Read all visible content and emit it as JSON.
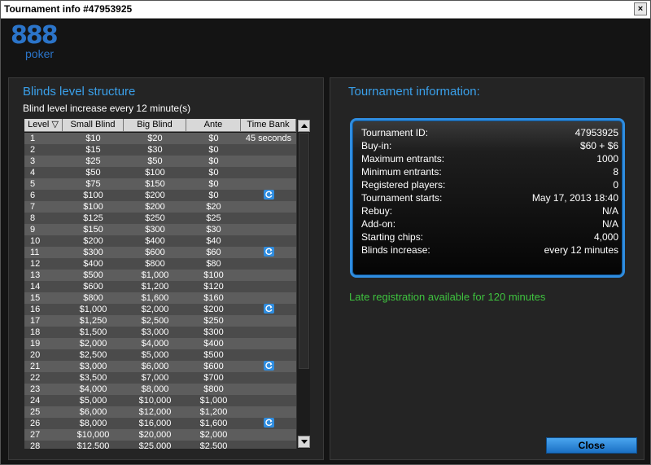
{
  "window": {
    "title": "Tournament info #47953925",
    "close_glyph": "×"
  },
  "logo": {
    "brand": "888",
    "sub": "poker"
  },
  "blinds": {
    "title": "Blinds level structure",
    "subtitle": "Blind level increase every 12 minute(s)",
    "columns": [
      "Level",
      "Small Blind",
      "Big Blind",
      "Ante",
      "Time Bank"
    ],
    "sort_glyph": "▽",
    "rows": [
      {
        "level": "1",
        "small": "$10",
        "big": "$20",
        "ante": "$0",
        "tb": "45 seconds"
      },
      {
        "level": "2",
        "small": "$15",
        "big": "$30",
        "ante": "$0",
        "tb": ""
      },
      {
        "level": "3",
        "small": "$25",
        "big": "$50",
        "ante": "$0",
        "tb": ""
      },
      {
        "level": "4",
        "small": "$50",
        "big": "$100",
        "ante": "$0",
        "tb": ""
      },
      {
        "level": "5",
        "small": "$75",
        "big": "$150",
        "ante": "$0",
        "tb": ""
      },
      {
        "level": "6",
        "small": "$100",
        "big": "$200",
        "ante": "$0",
        "tb": "icon"
      },
      {
        "level": "7",
        "small": "$100",
        "big": "$200",
        "ante": "$20",
        "tb": ""
      },
      {
        "level": "8",
        "small": "$125",
        "big": "$250",
        "ante": "$25",
        "tb": ""
      },
      {
        "level": "9",
        "small": "$150",
        "big": "$300",
        "ante": "$30",
        "tb": ""
      },
      {
        "level": "10",
        "small": "$200",
        "big": "$400",
        "ante": "$40",
        "tb": ""
      },
      {
        "level": "11",
        "small": "$300",
        "big": "$600",
        "ante": "$60",
        "tb": "icon"
      },
      {
        "level": "12",
        "small": "$400",
        "big": "$800",
        "ante": "$80",
        "tb": ""
      },
      {
        "level": "13",
        "small": "$500",
        "big": "$1,000",
        "ante": "$100",
        "tb": ""
      },
      {
        "level": "14",
        "small": "$600",
        "big": "$1,200",
        "ante": "$120",
        "tb": ""
      },
      {
        "level": "15",
        "small": "$800",
        "big": "$1,600",
        "ante": "$160",
        "tb": ""
      },
      {
        "level": "16",
        "small": "$1,000",
        "big": "$2,000",
        "ante": "$200",
        "tb": "icon"
      },
      {
        "level": "17",
        "small": "$1,250",
        "big": "$2,500",
        "ante": "$250",
        "tb": ""
      },
      {
        "level": "18",
        "small": "$1,500",
        "big": "$3,000",
        "ante": "$300",
        "tb": ""
      },
      {
        "level": "19",
        "small": "$2,000",
        "big": "$4,000",
        "ante": "$400",
        "tb": ""
      },
      {
        "level": "20",
        "small": "$2,500",
        "big": "$5,000",
        "ante": "$500",
        "tb": ""
      },
      {
        "level": "21",
        "small": "$3,000",
        "big": "$6,000",
        "ante": "$600",
        "tb": "icon"
      },
      {
        "level": "22",
        "small": "$3,500",
        "big": "$7,000",
        "ante": "$700",
        "tb": ""
      },
      {
        "level": "23",
        "small": "$4,000",
        "big": "$8,000",
        "ante": "$800",
        "tb": ""
      },
      {
        "level": "24",
        "small": "$5,000",
        "big": "$10,000",
        "ante": "$1,000",
        "tb": ""
      },
      {
        "level": "25",
        "small": "$6,000",
        "big": "$12,000",
        "ante": "$1,200",
        "tb": ""
      },
      {
        "level": "26",
        "small": "$8,000",
        "big": "$16,000",
        "ante": "$1,600",
        "tb": "icon"
      },
      {
        "level": "27",
        "small": "$10,000",
        "big": "$20,000",
        "ante": "$2,000",
        "tb": ""
      },
      {
        "level": "28",
        "small": "$12,500",
        "big": "$25,000",
        "ante": "$2,500",
        "tb": ""
      }
    ]
  },
  "info": {
    "title": "Tournament information:",
    "rows": [
      {
        "k": "Tournament ID:",
        "v": "47953925"
      },
      {
        "k": "Buy-in:",
        "v": "$60 + $6"
      },
      {
        "k": "Maximum entrants:",
        "v": "1000"
      },
      {
        "k": "Minimum entrants:",
        "v": "8"
      },
      {
        "k": "Registered players:",
        "v": "0"
      },
      {
        "k": "Tournament starts:",
        "v": "May 17, 2013 18:40"
      },
      {
        "k": "Rebuy:",
        "v": "N/A"
      },
      {
        "k": "Add-on:",
        "v": "N/A"
      },
      {
        "k": "Starting chips:",
        "v": "4,000"
      },
      {
        "k": "Blinds increase:",
        "v": "every 12 minutes"
      }
    ],
    "late_registration": "Late registration available for 120 minutes"
  },
  "buttons": {
    "close": "Close"
  },
  "colors": {
    "accent": "#2f8de0",
    "title_blue": "#3aa0ea",
    "late_green": "#3fc33f"
  }
}
